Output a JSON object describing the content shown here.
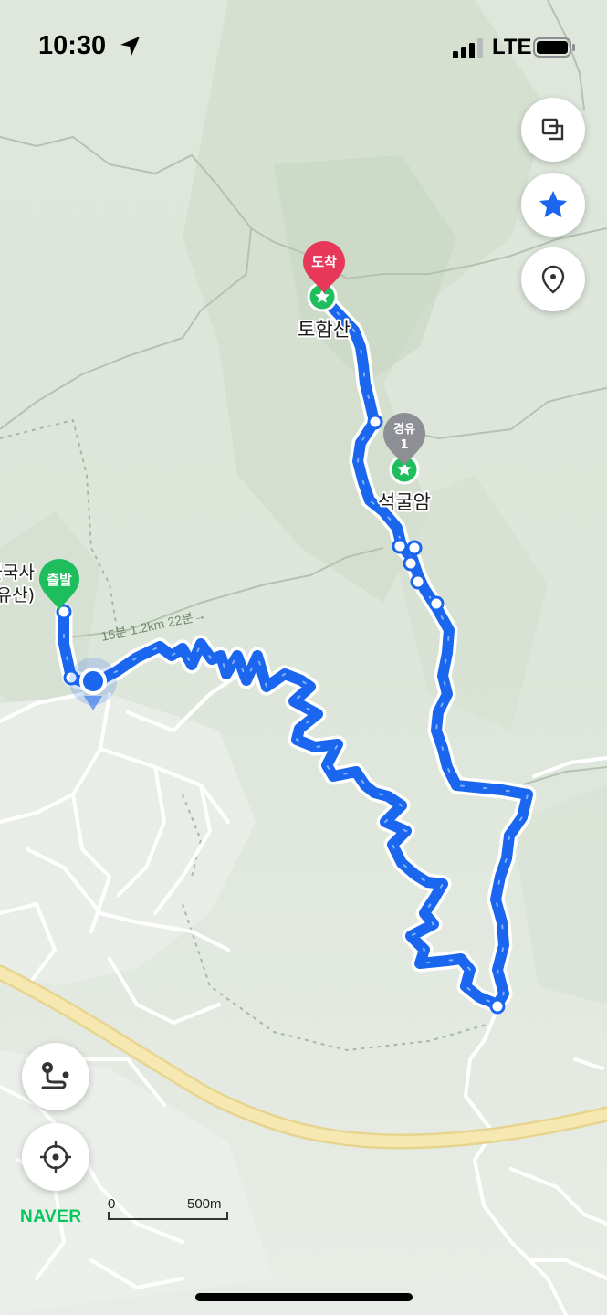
{
  "status_bar": {
    "time": "10:30",
    "network": "LTE"
  },
  "map": {
    "places": {
      "summit": "토함산",
      "seokguram": "석굴암",
      "temple_partial_1": "불국사",
      "temple_partial_2": "유산)"
    },
    "markers": {
      "start": "출발",
      "waypoint_line1": "경유",
      "waypoint_line2": "1",
      "end": "도착"
    },
    "trail_label": "15분 1.2km 22분→"
  },
  "scale": {
    "zero": "0",
    "distance": "500m"
  },
  "brand": "NAVER",
  "colors": {
    "route": "#1a66ee",
    "start_marker": "#1ebe5e",
    "end_marker": "#e8385a",
    "waypoint_marker": "#8d8f94",
    "brand": "#03c75a"
  },
  "icons": [
    "location-arrow-icon",
    "signal-icon",
    "battery-icon",
    "layers-icon",
    "star-icon",
    "pin-icon",
    "route-icon",
    "crosshair-icon"
  ]
}
